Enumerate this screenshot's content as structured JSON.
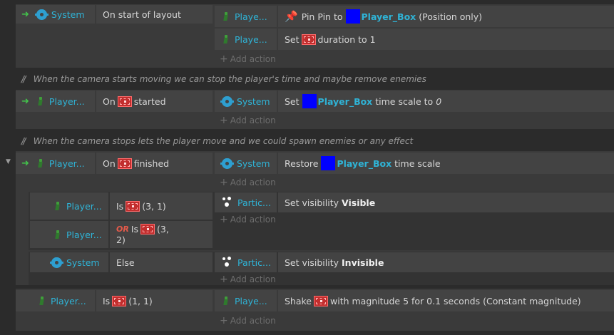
{
  "add_action_label": "Add action",
  "events": [
    {
      "object": "System",
      "condition": "On start of layout",
      "actions": [
        {
          "object": "Playe...",
          "pre": "Pin Pin to",
          "target": "Player_Box",
          "post": "(Position only)"
        },
        {
          "object": "Playe...",
          "pre": "Set",
          "behavior": "SnapTo",
          "post": "duration to 1"
        }
      ]
    },
    {
      "comment": "When the camera starts moving we can stop the player's time and maybe remove enemies",
      "object": "Player...",
      "condition_pre": "On",
      "behavior": "SnapTo",
      "condition_post": "started",
      "action_object": "System",
      "action_pre": "Set",
      "action_target": "Player_Box",
      "action_mid": "time scale to",
      "action_value": "0"
    },
    {
      "comment": "When the camera stops lets the player move and we could spawn enemies or any effect",
      "object": "Player...",
      "condition_pre": "On",
      "behavior": "SnapTo",
      "condition_post": "finished",
      "action_object": "System",
      "action_pre": "Restore",
      "action_target": "Player_Box",
      "action_post": "time scale",
      "subevents": [
        {
          "conditions": [
            {
              "object": "Player...",
              "pre": "Is",
              "behavior": "SnapTo",
              "post": "(3, 1)"
            },
            {
              "object": "Player...",
              "or": "OR",
              "pre": "Is",
              "behavior": "SnapTo",
              "post": "(3,",
              "post2": "2)"
            }
          ],
          "action_object": "Partic...",
          "action_pre": "Set visibility",
          "action_value": "Visible"
        },
        {
          "object": "System",
          "condition": "Else",
          "action_object": "Partic...",
          "action_pre": "Set visibility",
          "action_value": "Invisible"
        }
      ]
    },
    {
      "object": "Player...",
      "condition_pre": "Is",
      "behavior": "SnapTo",
      "condition_post": "(1, 1)",
      "action_object": "Playe...",
      "action_pre": "Shake",
      "action_post": "with magnitude 5 for 0.1 seconds (Constant magnitude)"
    }
  ]
}
